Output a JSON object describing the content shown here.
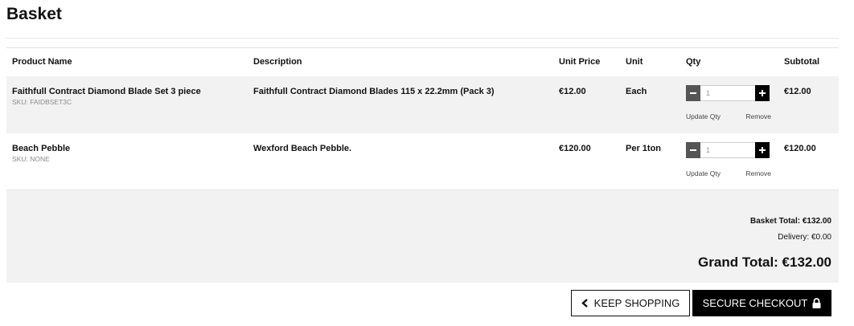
{
  "page": {
    "title": "Basket"
  },
  "table": {
    "headers": {
      "product_name": "Product Name",
      "description": "Description",
      "unit_price": "Unit Price",
      "unit": "Unit",
      "qty": "Qty",
      "subtotal": "Subtotal"
    },
    "rows": [
      {
        "name": "Faithfull Contract Diamond Blade Set 3 piece",
        "sku": "SKU: FAIDBSET3C",
        "description": "Faithfull Contract Diamond Blades 115 x 22.2mm (Pack 3)",
        "unit_price": "€12.00",
        "unit": "Each",
        "qty": "1",
        "subtotal": "€12.00",
        "update_label": "Update Qty",
        "remove_label": "Remove"
      },
      {
        "name": "Beach Pebble",
        "sku": "SKU: NONE",
        "description": "Wexford Beach Pebble.",
        "unit_price": "€120.00",
        "unit": "Per 1ton",
        "qty": "1",
        "subtotal": "€120.00",
        "update_label": "Update Qty",
        "remove_label": "Remove"
      }
    ]
  },
  "totals": {
    "basket_total": "Basket Total: €132.00",
    "delivery": "Delivery: €0.00",
    "grand_total": "Grand Total: €132.00"
  },
  "actions": {
    "keep_shopping": "KEEP SHOPPING",
    "secure_checkout": "SECURE CHECKOUT"
  },
  "icons": {
    "minus": "minus-icon",
    "plus": "plus-icon",
    "back": "chevron-left-icon",
    "lock": "lock-icon"
  },
  "colors": {
    "row_shade": "#f2f2f2",
    "button_dark": "#000000",
    "minus_button": "#555555"
  }
}
